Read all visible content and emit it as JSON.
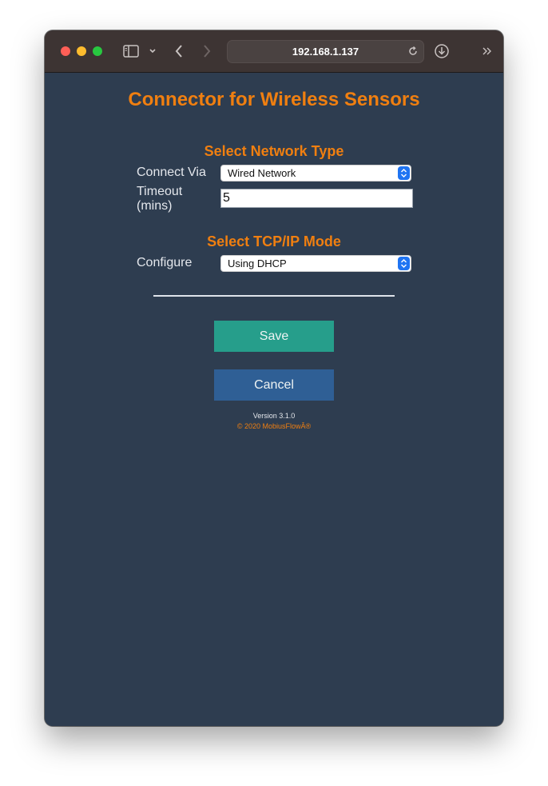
{
  "browser": {
    "url": "192.168.1.137"
  },
  "page": {
    "title": "Connector for Wireless Sensors",
    "network_section": {
      "heading": "Select Network Type",
      "connect_via_label": "Connect Via",
      "connect_via_value": "Wired Network",
      "timeout_label_line1": "Timeout",
      "timeout_label_line2": "(mins)",
      "timeout_value": "5"
    },
    "tcpip_section": {
      "heading": "Select TCP/IP Mode",
      "configure_label": "Configure",
      "configure_value": "Using DHCP"
    },
    "buttons": {
      "save_label": "Save",
      "cancel_label": "Cancel"
    },
    "footer": {
      "version": "Version 3.1.0",
      "copyright": "© 2020 MobiusFlowÂ®"
    }
  },
  "colors": {
    "accent": "#f07f10",
    "background": "#2e3d50",
    "save_button": "#269e8b",
    "cancel_button": "#2f5f95"
  },
  "icons": [
    "sidebar-toggle-icon",
    "chevron-down-icon",
    "back-arrow-icon",
    "forward-arrow-icon",
    "reload-icon",
    "download-icon",
    "more-chevrons-icon"
  ]
}
